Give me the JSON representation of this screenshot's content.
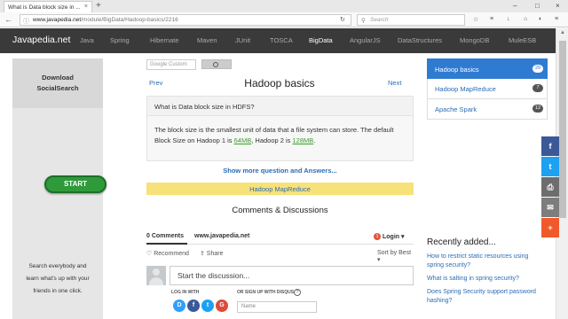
{
  "browser": {
    "tab_title": "What is Data block size in ...",
    "tab_close": "×",
    "new_tab": "+",
    "url_host": "www.javapedia.net",
    "url_path": "/module/BigData/Hadoop-basics/2216",
    "search_placeholder": "Search",
    "window_controls": [
      "–",
      "□",
      "×"
    ]
  },
  "site_nav": {
    "brand": "Javapedia.net",
    "links": [
      "Java",
      "Spring",
      "Hibernate",
      "Maven",
      "JUnit",
      "TOSCA",
      "BigData",
      "AngularJS",
      "DataStructures",
      "MongoDB",
      "MuleESB"
    ],
    "active": "BigData"
  },
  "left_ad": {
    "heading_line1": "Download",
    "heading_line2": "SocialSearch",
    "button": "START",
    "footer_line1": "Search everybody and",
    "footer_line2": "learn what's up with your",
    "footer_line3": "friends in one click."
  },
  "custom_search": {
    "placeholder": "Google Custom"
  },
  "page": {
    "prev": "Prev",
    "next": "Next",
    "title": "Hadoop basics"
  },
  "qa": {
    "question": "What is Data block size in HDFS?",
    "answer_part1": "The block size is the smallest unit of data that a file system can store. The default Block Size on Hadoop 1 is ",
    "answer_hl1": "64MB",
    "answer_part2": ", Hadoop 2 is ",
    "answer_hl2": "128MB",
    "answer_part3": "."
  },
  "show_more": "Show more question and Answers...",
  "yellow_link": "Hadoop MapReduce",
  "comments_heading": "Comments & Discussions",
  "disqus": {
    "count": "0 Comments",
    "site": "www.javapedia.net",
    "badge": "1",
    "login": "Login ▾",
    "recommend": "♡ Recommend",
    "share": "⇪ Share",
    "sort": "Sort by Best ▾",
    "discuss_placeholder": "Start the discussion...",
    "log_in_with": "LOG IN WITH",
    "or_sign_up": "OR SIGN UP WITH DISQUS",
    "qmark": "?",
    "name_placeholder": "Name",
    "social": [
      {
        "letter": "D",
        "color": "#2e9fff"
      },
      {
        "letter": "f",
        "color": "#3b5998"
      },
      {
        "letter": "t",
        "color": "#1da1f2"
      },
      {
        "letter": "G",
        "color": "#dd4b39"
      }
    ]
  },
  "sidebar": {
    "items": [
      {
        "label": "Hadoop basics",
        "count": "29",
        "active": true
      },
      {
        "label": "Hadoop MapReduce",
        "count": "7",
        "active": false
      },
      {
        "label": "Apache Spark",
        "count": "12",
        "active": false
      }
    ]
  },
  "share_buttons": [
    {
      "name": "facebook",
      "glyph": "f",
      "color": "#3b5998"
    },
    {
      "name": "twitter",
      "glyph": "t",
      "color": "#1da1f2"
    },
    {
      "name": "print",
      "glyph": "⎙",
      "color": "#6d6d6d"
    },
    {
      "name": "email",
      "glyph": "✉",
      "color": "#7d7d7d"
    },
    {
      "name": "more",
      "glyph": "+",
      "color": "#f1592a"
    }
  ],
  "recent": {
    "heading": "Recently added...",
    "items": [
      "How to restrict static resources using spring security?",
      "What is salting in spring security?",
      "Does Spring Security support password hashing?"
    ]
  }
}
